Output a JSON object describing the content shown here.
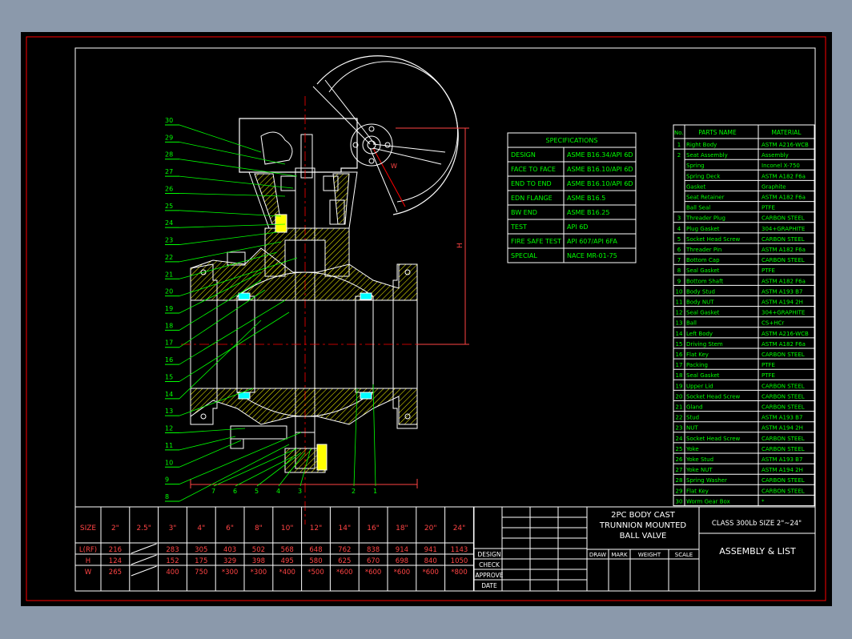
{
  "specifications": {
    "title": "SPECIFICATIONS",
    "rows": [
      [
        "DESIGN",
        "ASME B16.34/API 6D"
      ],
      [
        "FACE TO FACE",
        "ASME B16.10/API 6D"
      ],
      [
        "END TO END",
        "ASME B16.10/API 6D"
      ],
      [
        "EDN FLANGE",
        "ASME B16.5"
      ],
      [
        "BW END",
        "ASME B16.25"
      ],
      [
        "TEST",
        "API 6D"
      ],
      [
        "FIRE SAFE TEST",
        "API 607/API 6FA"
      ],
      [
        "SPECIAL",
        "NACE MR-01-75"
      ]
    ]
  },
  "parts_list": {
    "headers": [
      "No.",
      "PARTS NAME",
      "MATERIAL"
    ],
    "rows": [
      [
        "1",
        "Right Body",
        "ASTM A216-WCB"
      ],
      [
        "2",
        "Seat Assembly",
        "Assembly"
      ],
      [
        "",
        "Spring",
        "Inconel X-750"
      ],
      [
        "",
        "Spring Deck",
        "ASTM A182 F6a"
      ],
      [
        "",
        "Gasket",
        "Graphite"
      ],
      [
        "",
        "Seat Retainer",
        "ASTM A182 F6a"
      ],
      [
        "",
        "Ball Seal",
        "PTFE"
      ],
      [
        "3",
        "Threader Plug",
        "CARBON STEEL"
      ],
      [
        "4",
        "Plug Gasket",
        "304+GRAPHITE"
      ],
      [
        "5",
        "Socket Head Screw",
        "CARBON STEEL"
      ],
      [
        "6",
        "Threader Pin",
        "ASTM A182 F6a"
      ],
      [
        "7",
        "Bottom Cap",
        "CARBON STEEL"
      ],
      [
        "8",
        "Seal Gasket",
        "PTFE"
      ],
      [
        "9",
        "Bottom Shaft",
        "ASTM A182 F6a"
      ],
      [
        "10",
        "Body Stud",
        "ASTM A193 B7"
      ],
      [
        "11",
        "Body NUT",
        "ASTM A194 2H"
      ],
      [
        "12",
        "Seal Gasket",
        "304+GRAPHITE"
      ],
      [
        "13",
        "Ball",
        "CS+HCr"
      ],
      [
        "14",
        "Left Body",
        "ASTM A216-WCB"
      ],
      [
        "15",
        "Driving Stem",
        "ASTM A182 F6a"
      ],
      [
        "16",
        "Flat Key",
        "CARBON STEEL"
      ],
      [
        "17",
        "Packing",
        "PTFE"
      ],
      [
        "18",
        "Seal Gasket",
        "PTFE"
      ],
      [
        "19",
        "Upper Lid",
        "CARBON STEEL"
      ],
      [
        "20",
        "Socket Head Screw",
        "CARBON STEEL"
      ],
      [
        "21",
        "Gland",
        "CARBON STEEL"
      ],
      [
        "22",
        "Stud",
        "ASTM A193 B7"
      ],
      [
        "23",
        "NUT",
        "ASTM A194 2H"
      ],
      [
        "24",
        "Socket Head Screw",
        "CARBON STEEL"
      ],
      [
        "25",
        "Yoke",
        "CARBON STEEL"
      ],
      [
        "26",
        "Yoke Stud",
        "ASTM A193 B7"
      ],
      [
        "27",
        "Yoke NUT",
        "ASTM A194 2H"
      ],
      [
        "28",
        "Spring Washer",
        "CARBON STEEL"
      ],
      [
        "29",
        "Flat Key",
        "CARBON STEEL"
      ],
      [
        "30",
        "Worm Gear Box",
        "*"
      ]
    ]
  },
  "dimensions": {
    "size_label": "SIZE",
    "sizes": [
      "2\"",
      "2.5\"",
      "3\"",
      "4\"",
      "6\"",
      "8\"",
      "10\"",
      "12\"",
      "14\"",
      "16\"",
      "18\"",
      "20\"",
      "24\""
    ],
    "rows": [
      {
        "label": "L(RF)",
        "values": [
          "216",
          "",
          "283",
          "305",
          "403",
          "502",
          "568",
          "648",
          "762",
          "838",
          "914",
          "941",
          "1143"
        ]
      },
      {
        "label": "H",
        "values": [
          "124",
          "",
          "152",
          "175",
          "329",
          "398",
          "495",
          "580",
          "625",
          "670",
          "698",
          "840",
          "1050"
        ]
      },
      {
        "label": "W",
        "values": [
          "265",
          "",
          "400",
          "750",
          "*300",
          "*300",
          "*400",
          "*500",
          "*600",
          "*600",
          "*600",
          "*600",
          "*800"
        ]
      }
    ]
  },
  "approval_labels": [
    "DESIGN",
    "CHECK",
    "APPROVE",
    "DATE"
  ],
  "title_block": {
    "lines": [
      "2PC BODY CAST",
      "TRUNNION MOUNTED",
      "BALL VALVE"
    ],
    "class_size": "CLASS 300Lb SIZE 2\"~24\"",
    "assembly": "ASSEMBLY & LIST",
    "small_labels": [
      "DRAW",
      "MARK",
      "WEIGHT",
      "SCALE"
    ]
  },
  "callouts_left": [
    "30",
    "29",
    "28",
    "27",
    "26",
    "25",
    "24",
    "23",
    "22",
    "21",
    "20",
    "19",
    "18",
    "17",
    "16",
    "15",
    "14",
    "13",
    "12",
    "11",
    "10",
    "9",
    "8"
  ],
  "callouts_bottom": [
    "7",
    "6",
    "5",
    "4",
    "3",
    "2",
    "1"
  ],
  "dim_labels": {
    "h": "H",
    "w": "W"
  },
  "colors": {
    "background": "#000000",
    "frame": "#ff0000",
    "line": "#ffffff",
    "text": "#00ff00",
    "dims": "#ff4444",
    "hatch": "#ffff00",
    "cyan": "#00ffff",
    "gui": "#8b99ab"
  }
}
